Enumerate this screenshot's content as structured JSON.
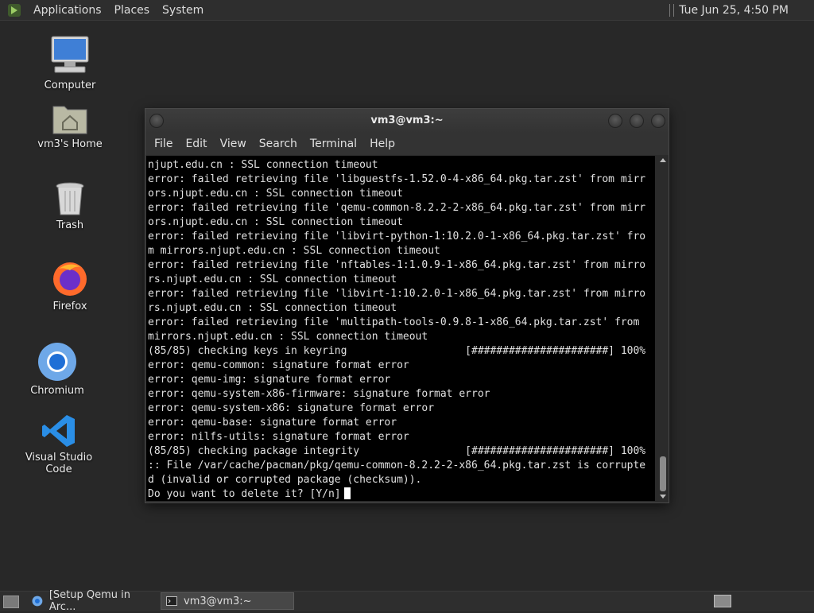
{
  "top_panel": {
    "menus": [
      "Applications",
      "Places",
      "System"
    ],
    "clock": "Tue Jun 25,  4:50 PM"
  },
  "desktop": {
    "icons": [
      {
        "label": "Computer",
        "icon": "computer-icon"
      },
      {
        "label": "vm3's Home",
        "icon": "home-folder-icon"
      },
      {
        "label": "Trash",
        "icon": "trash-icon"
      },
      {
        "label": "Firefox",
        "icon": "firefox-icon"
      },
      {
        "label": "Chromium",
        "icon": "chromium-icon"
      },
      {
        "label": "Visual Studio Code",
        "icon": "vscode-icon"
      }
    ]
  },
  "window": {
    "title": "vm3@vm3:~",
    "menu": [
      "File",
      "Edit",
      "View",
      "Search",
      "Terminal",
      "Help"
    ]
  },
  "terminal": {
    "lines": [
      "njupt.edu.cn : SSL connection timeout",
      "error: failed retrieving file 'libguestfs-1.52.0-4-x86_64.pkg.tar.zst' from mirr",
      "ors.njupt.edu.cn : SSL connection timeout",
      "error: failed retrieving file 'qemu-common-8.2.2-2-x86_64.pkg.tar.zst' from mirr",
      "ors.njupt.edu.cn : SSL connection timeout",
      "error: failed retrieving file 'libvirt-python-1:10.2.0-1-x86_64.pkg.tar.zst' fro",
      "m mirrors.njupt.edu.cn : SSL connection timeout",
      "error: failed retrieving file 'nftables-1:1.0.9-1-x86_64.pkg.tar.zst' from mirro",
      "rs.njupt.edu.cn : SSL connection timeout",
      "error: failed retrieving file 'libvirt-1:10.2.0-1-x86_64.pkg.tar.zst' from mirro",
      "rs.njupt.edu.cn : SSL connection timeout",
      "error: failed retrieving file 'multipath-tools-0.9.8-1-x86_64.pkg.tar.zst' from ",
      "mirrors.njupt.edu.cn : SSL connection timeout",
      "(85/85) checking keys in keyring                   [######################] 100%",
      "error: qemu-common: signature format error",
      "error: qemu-img: signature format error",
      "error: qemu-system-x86-firmware: signature format error",
      "error: qemu-system-x86: signature format error",
      "error: qemu-base: signature format error",
      "error: nilfs-utils: signature format error",
      "(85/85) checking package integrity                 [######################] 100%",
      ":: File /var/cache/pacman/pkg/qemu-common-8.2.2-2-x86_64.pkg.tar.zst is corrupte",
      "d (invalid or corrupted package (checksum))."
    ],
    "prompt": "Do you want to delete it? [Y/n]"
  },
  "taskbar": {
    "tasks": [
      {
        "label": "[Setup Qemu in Arc...",
        "icon": "chromium-icon",
        "active": false
      },
      {
        "label": "vm3@vm3:~",
        "icon": "terminal-icon",
        "active": true
      }
    ]
  }
}
